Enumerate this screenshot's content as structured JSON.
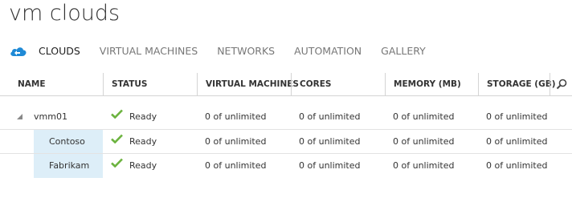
{
  "page": {
    "title": "vm clouds"
  },
  "tabs": [
    {
      "label": "CLOUDS",
      "active": true
    },
    {
      "label": "VIRTUAL MACHINES",
      "active": false
    },
    {
      "label": "NETWORKS",
      "active": false
    },
    {
      "label": "AUTOMATION",
      "active": false
    },
    {
      "label": "GALLERY",
      "active": false
    }
  ],
  "icons": {
    "tab_icon": "clouds-icon",
    "search": "search-icon",
    "status": "checkmark-icon",
    "expander": "collapse-triangle-icon"
  },
  "colors": {
    "accent_blue": "#1f8ad6",
    "ready_green": "#6cb33f",
    "selected_name_bg": "#ddeef8"
  },
  "table": {
    "columns": [
      "NAME",
      "STATUS",
      "VIRTUAL MACHINES",
      "CORES",
      "MEMORY (MB)",
      "STORAGE (GB)"
    ],
    "rows": [
      {
        "name": "vmm01",
        "status": "Ready",
        "vms": "0 of unlimited",
        "cores": "0 of unlimited",
        "memory": "0 of unlimited",
        "storage": "0 of unlimited"
      },
      {
        "name": "Contoso",
        "status": "Ready",
        "vms": "0 of unlimited",
        "cores": "0 of unlimited",
        "memory": "0 of unlimited",
        "storage": "0 of unlimited"
      },
      {
        "name": "Fabrikam",
        "status": "Ready",
        "vms": "0 of unlimited",
        "cores": "0 of unlimited",
        "memory": "0 of unlimited",
        "storage": "0 of unlimited"
      }
    ]
  }
}
